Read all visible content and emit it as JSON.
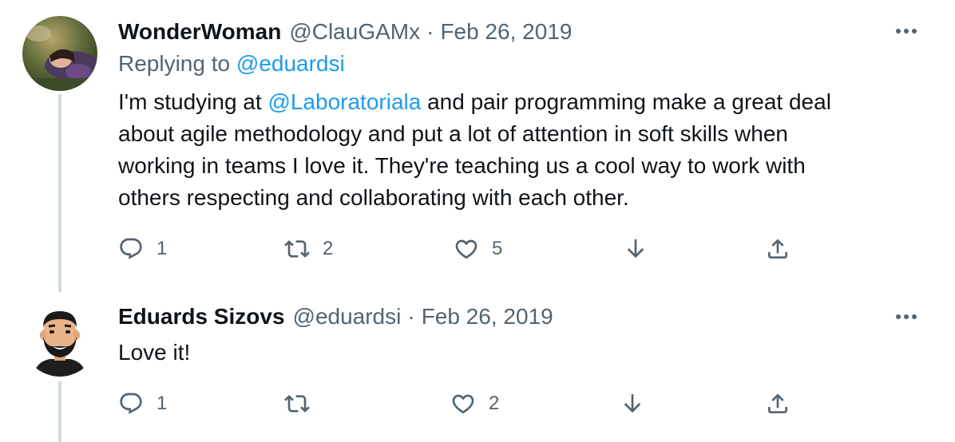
{
  "tweets": [
    {
      "display_name": "WonderWoman",
      "handle": "@ClauGAMx",
      "separator": "·",
      "date": "Feb 26, 2019",
      "replying_to_label": "Replying to",
      "replying_to_handle": "@eduardsi",
      "body": {
        "line1_pre": "I'm studying at ",
        "line1_mention": "@Laboratoriala",
        "line1_post": " and pair programming make a great deal",
        "line2": "about agile methodology and put a lot of attention in soft skills when",
        "line3": "working in teams I love it. They're teaching us a cool way to work with",
        "line4": "others respecting and collaborating with each other."
      },
      "actions": {
        "reply_count": "1",
        "retweet_count": "2",
        "like_count": "5"
      },
      "avatar_icon": "profile-photo-woman"
    },
    {
      "display_name": "Eduards Sizovs",
      "handle": "@eduardsi",
      "separator": "·",
      "date": "Feb 26, 2019",
      "body": {
        "line1": "Love it!"
      },
      "actions": {
        "reply_count": "1",
        "retweet_count": "",
        "like_count": "2"
      },
      "avatar_icon": "cartoon-bearded-man-avatar"
    }
  ],
  "colors": {
    "text_primary": "#0f1419",
    "text_secondary": "#536471",
    "link": "#1d9bf0",
    "thread_line": "#cfd9de"
  }
}
